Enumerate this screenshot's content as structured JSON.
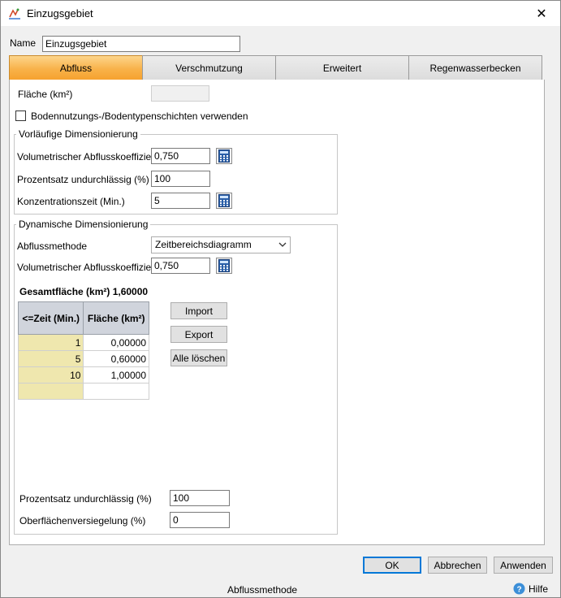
{
  "window": {
    "title": "Einzugsgebiet",
    "close_glyph": "✕"
  },
  "name_field": {
    "label": "Name",
    "value": "Einzugsgebiet"
  },
  "tabs": [
    {
      "label": "Abfluss",
      "active": true
    },
    {
      "label": "Verschmutzung",
      "active": false
    },
    {
      "label": "Erweitert",
      "active": false
    },
    {
      "label": "Regenwasserbecken",
      "active": false
    }
  ],
  "flaeche": {
    "label": "Fläche (km²)",
    "value": ""
  },
  "bodennutzung": {
    "label": "Bodennutzungs-/Bodentypenschichten verwenden",
    "checked": false
  },
  "vorlaeufig": {
    "title": "Vorläufige Dimensionierung",
    "vol_label": "Volumetrischer Abflusskoeffizient",
    "vol_value": "0,750",
    "prozent_label": "Prozentsatz undurchlässig (%)",
    "prozent_value": "100",
    "konz_label": "Konzentrationszeit (Min.)",
    "konz_value": "5"
  },
  "dynamisch": {
    "title": "Dynamische Dimensionierung",
    "methode_label": "Abflussmethode",
    "methode_value": "Zeitbereichsdiagramm",
    "vol_label": "Volumetrischer Abflusskoeffizient",
    "vol_value": "0,750",
    "gesamt_label": "Gesamtfläche (km²) 1,60000",
    "table": {
      "headers": [
        "<=Zeit (Min.)",
        "Fläche (km²)"
      ],
      "rows": [
        [
          "1",
          "0,00000"
        ],
        [
          "5",
          "0,60000"
        ],
        [
          "10",
          "1,00000"
        ],
        [
          "",
          ""
        ]
      ]
    },
    "buttons": {
      "import": "Import",
      "export": "Export",
      "clear": "Alle löschen"
    },
    "prozent_label": "Prozentsatz undurchlässig (%)",
    "prozent_value": "100",
    "versiegelung_label": "Oberflächenversiegelung (%)",
    "versiegelung_value": "0"
  },
  "footer": {
    "ok": "OK",
    "cancel": "Abbrechen",
    "apply": "Anwenden",
    "status": "Abflussmethode",
    "help": "Hilfe"
  },
  "colors": {
    "active_tab": "#f8b24a",
    "grid_key": "#efe7ae",
    "grid_header": "#d0d4dc",
    "accent": "#0078d7"
  }
}
